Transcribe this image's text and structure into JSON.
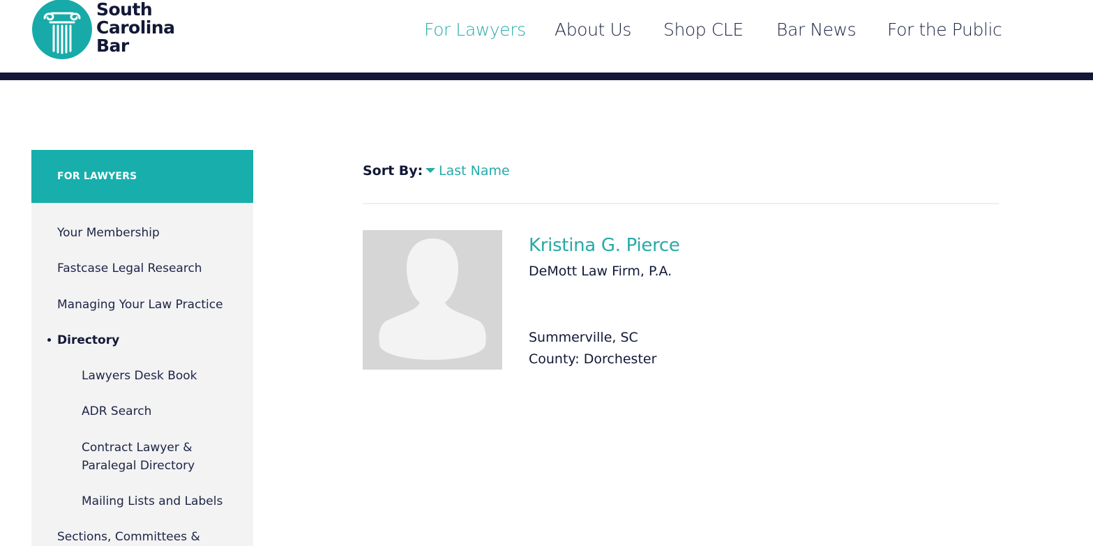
{
  "header": {
    "logo_lines": [
      "South",
      "Carolina",
      "Bar"
    ],
    "nav": [
      {
        "label": "For Lawyers",
        "active": true
      },
      {
        "label": "About Us",
        "active": false
      },
      {
        "label": "Shop CLE",
        "active": false
      },
      {
        "label": "Bar News",
        "active": false
      },
      {
        "label": "For the Public",
        "active": false
      }
    ]
  },
  "sidebar": {
    "heading": "FOR LAWYERS",
    "items": [
      {
        "label": "Your Membership"
      },
      {
        "label": "Fastcase Legal Research"
      },
      {
        "label": "Managing Your Law Practice"
      },
      {
        "label": "Directory",
        "active": true
      },
      {
        "label": "Lawyers Desk Book"
      },
      {
        "label": "ADR Search"
      },
      {
        "label": "Contract Lawyer &"
      },
      {
        "label": "Paralegal Directory"
      },
      {
        "label": "Mailing Lists and Labels"
      },
      {
        "label": "Sections, Committees &"
      }
    ]
  },
  "results": {
    "sort_label": "Sort By:",
    "sort_value": "Last Name",
    "items": [
      {
        "name": "Kristina G. Pierce",
        "firm": "DeMott Law Firm, P.A.",
        "location": "Summerville, SC",
        "county": "County: Dorchester"
      }
    ]
  },
  "colors": {
    "accent": "#17aeac",
    "navy": "#121836",
    "sidebar_bg": "#f3f3f4",
    "avatar_bg": "#d6d6d6"
  },
  "icons": {
    "logo": "ionic-column-icon",
    "sort": "caret-down-icon",
    "avatar": "person-silhouette-icon"
  }
}
